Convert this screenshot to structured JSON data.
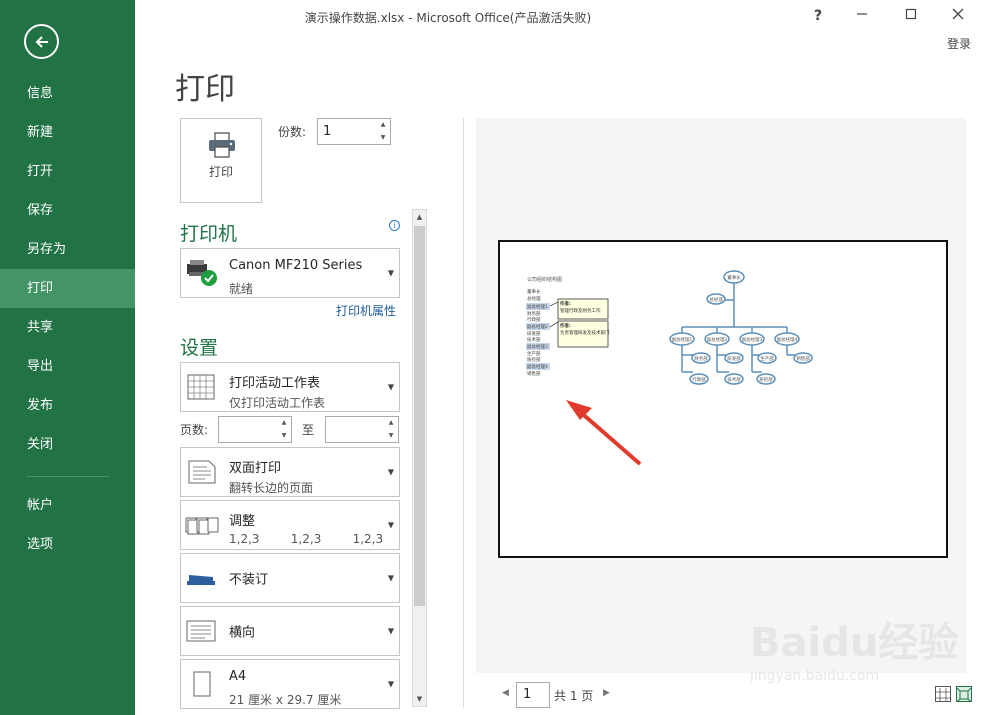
{
  "window": {
    "title": "演示操作数据.xlsx - Microsoft Office(产品激活失败)",
    "help": "?",
    "login": "登录"
  },
  "sidebar": {
    "items": [
      {
        "label": "信息"
      },
      {
        "label": "新建"
      },
      {
        "label": "打开"
      },
      {
        "label": "保存"
      },
      {
        "label": "另存为"
      },
      {
        "label": "打印",
        "active": true
      },
      {
        "label": "共享"
      },
      {
        "label": "导出"
      },
      {
        "label": "发布"
      },
      {
        "label": "关闭"
      },
      {
        "label": "帐户"
      },
      {
        "label": "选项"
      }
    ]
  },
  "page_title": "打印",
  "print_button": "打印",
  "copies": {
    "label": "份数:",
    "value": "1"
  },
  "printer": {
    "heading": "打印机",
    "name": "Canon MF210 Series",
    "status": "就绪",
    "properties_link": "打印机属性"
  },
  "settings": {
    "heading": "设置",
    "print_what": {
      "title": "打印活动工作表",
      "sub": "仅打印活动工作表"
    },
    "pages": {
      "label": "页数:",
      "to": "至",
      "from_value": "",
      "to_value": ""
    },
    "duplex": {
      "title": "双面打印",
      "sub": "翻转长边的页面"
    },
    "collate": {
      "title": "调整",
      "sub": "1,2,3    1,2,3    1,2,3"
    },
    "staple": {
      "title": "不装订"
    },
    "orientation": {
      "title": "横向"
    },
    "paper": {
      "title": "A4",
      "sub": "21 厘米 x 29.7 厘米"
    }
  },
  "preview": {
    "sheet_title": "公司组织结构图",
    "list_items": [
      "董事长",
      "总经理",
      "副总经理1",
      "财务部",
      "行政部",
      "副总经理2",
      "研发部",
      "技术部",
      "副总经理3",
      "生产部",
      "质检部",
      "副总经理4",
      "销售部"
    ],
    "comment1_author": "作者:",
    "comment1_text": "管理行政及财务工作",
    "comment2_author": "作者:",
    "comment2_text": "负责管理研发及技术部门",
    "org_nodes": [
      "董事长",
      "总经理",
      "副总经理1",
      "副总经理2",
      "副总经理3",
      "副总经理4",
      "财务部",
      "研发部",
      "生产部",
      "销售部",
      "行政部",
      "技术部",
      "质检部"
    ]
  },
  "pager": {
    "current": "1",
    "total": "共 1 页"
  },
  "watermark": {
    "brand": "Baidu经验",
    "url": "jingyan.baidu.com"
  }
}
